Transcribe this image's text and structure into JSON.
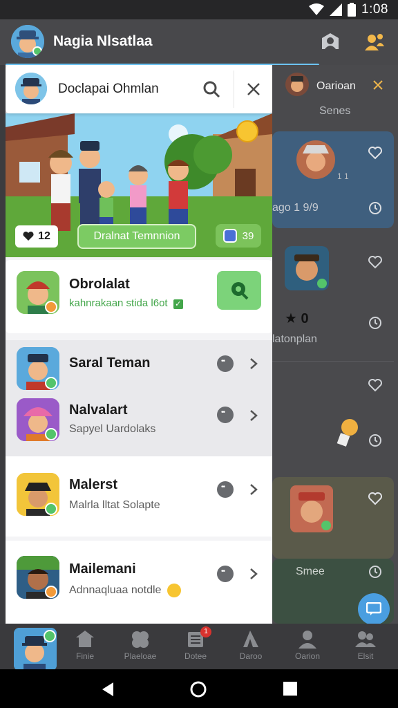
{
  "status_bar": {
    "time": "1:08"
  },
  "app_bar": {
    "title": "Nagia Nlsatlaa"
  },
  "search": {
    "text": "Doclapai Ohmlan"
  },
  "banner": {
    "likes": "12",
    "cta": "Dralnat Temnnion",
    "count": "39"
  },
  "featured": {
    "name": "Obrolalat",
    "subtitle": "kahnrakaan stida l6ot"
  },
  "list": [
    {
      "name": "Saral Teman",
      "subtitle": ""
    },
    {
      "name": "Nalvalart",
      "subtitle": "Sapyel Uardolaks"
    },
    {
      "name": "Malerst",
      "subtitle": "Malrla lltat Solapte"
    },
    {
      "name": "Mailemani",
      "subtitle": "Adnnaqluaa notdle"
    }
  ],
  "background": {
    "header_name": "Oarioan",
    "header_sub": "Senes",
    "card1_text": "ago 1 9/9",
    "card1_meta": "1 1",
    "card2_stars": "★ 0",
    "card2_text": "latonplan",
    "card3_label": "Smee"
  },
  "bottom_nav": {
    "items": [
      {
        "label": "Finie",
        "icon": "home-icon"
      },
      {
        "label": "Plaeloae",
        "icon": "puzzle-icon"
      },
      {
        "label": "Dotee",
        "icon": "document-icon",
        "badge": "1"
      },
      {
        "label": "Daroo",
        "icon": "tent-icon"
      },
      {
        "label": "Oarion",
        "icon": "person-icon"
      },
      {
        "label": "Elsit",
        "icon": "people-icon"
      }
    ]
  },
  "colors": {
    "accent_green": "#7ccb63",
    "accent_blue": "#6cc3f2",
    "app_bar": "#48484b"
  }
}
